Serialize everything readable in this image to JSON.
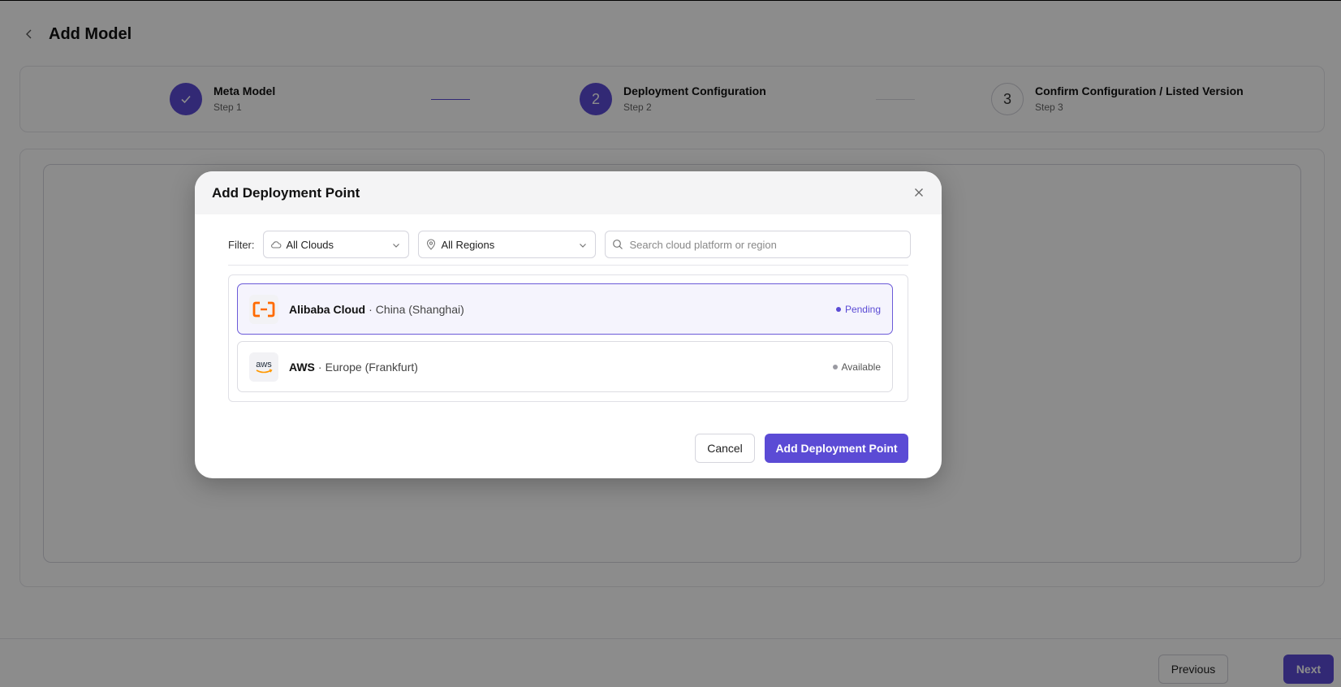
{
  "header": {
    "title": "Add Model"
  },
  "stepper": {
    "steps": [
      {
        "title": "Meta Model",
        "sub": "Step 1",
        "number": "1",
        "state": "done"
      },
      {
        "title": "Deployment Configuration",
        "sub": "Step 2",
        "number": "2",
        "state": "active"
      },
      {
        "title": "Confirm Configuration / Listed Version",
        "sub": "Step 3",
        "number": "3",
        "state": "todo"
      }
    ]
  },
  "footer": {
    "previous_label": "Previous",
    "next_label": "Next"
  },
  "modal": {
    "title": "Add Deployment Point",
    "filter_label": "Filter:",
    "clouds_select": {
      "value": "All Clouds",
      "icon": "cloud-icon"
    },
    "regions_select": {
      "value": "All Regions",
      "icon": "map-pin-icon"
    },
    "search": {
      "placeholder": "Search cloud platform or region",
      "value": ""
    },
    "items": [
      {
        "provider": "Alibaba Cloud",
        "separator": "·",
        "region": "China (Shanghai)",
        "status": "Pending",
        "selected": true,
        "logo": "alibaba-cloud-logo"
      },
      {
        "provider": "AWS",
        "separator": "·",
        "region": "Europe (Frankfurt)",
        "status": "Available",
        "selected": false,
        "logo": "aws-logo",
        "logo_text": "aws"
      }
    ],
    "cancel_label": "Cancel",
    "add_label": "Add Deployment Point"
  },
  "colors": {
    "accent": "#5b4bd5",
    "alibaba_orange": "#ff6a00",
    "aws_orange": "#ff9900"
  }
}
